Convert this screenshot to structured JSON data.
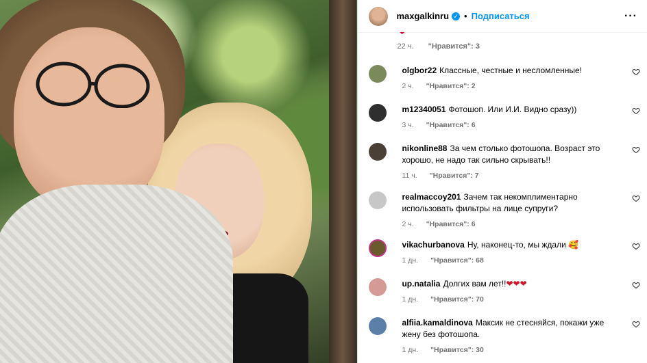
{
  "header": {
    "username": "maxgalkinru",
    "verified_mark": "✓",
    "separator": "•",
    "follow_label": "Подписаться",
    "more_label": "···"
  },
  "first_meta": {
    "time": "22 ч.",
    "likes": "\"Нравится\": 3"
  },
  "comments": [
    {
      "user": "olgbor22",
      "text": "Классные, честные и несломленные!",
      "time": "2 ч.",
      "likes": "\"Нравится\": 2",
      "avatar_color": "#7b8a5a"
    },
    {
      "user": "m12340051",
      "text": "Фотошоп. Или И.И. Видно сразу))",
      "time": "3 ч.",
      "likes": "\"Нравится\": 6",
      "avatar_color": "#2f2f2f"
    },
    {
      "user": "nikonline88",
      "text": "За чем столько фотошопа. Возраст это хорошо, не надо так сильно скрывать!!",
      "time": "11 ч.",
      "likes": "\"Нравится\": 7",
      "avatar_color": "#4a4036"
    },
    {
      "user": "realmaccoy201",
      "text": "Зачем так некомплиментарно использовать фильтры на лице супруги?",
      "time": "2 ч.",
      "likes": "\"Нравится\": 6",
      "avatar_color": "#c7c7c7"
    },
    {
      "user": "vikachurbanova",
      "text": "Ну, наконец-то, мы ждали 🥰",
      "time": "1 дн.",
      "likes": "\"Нравится\": 68",
      "avatar_color": "#6b5a2c"
    },
    {
      "user": "up.natalia",
      "text": "Долгих вам лет!!",
      "hearts": "❤❤❤",
      "time": "1 дн.",
      "likes": "\"Нравится\": 70",
      "avatar_color": "#d39a96"
    },
    {
      "user": "alfiia.kamaldinova",
      "text": "Максик не стесняйся, покажи уже жену без фотошопа.",
      "time": "1 дн.",
      "likes": "\"Нравится\": 30",
      "avatar_color": "#5b7fa8"
    }
  ],
  "colors": {
    "accent": "#0095f6",
    "muted": "#737373",
    "heart": "#d1142b"
  }
}
